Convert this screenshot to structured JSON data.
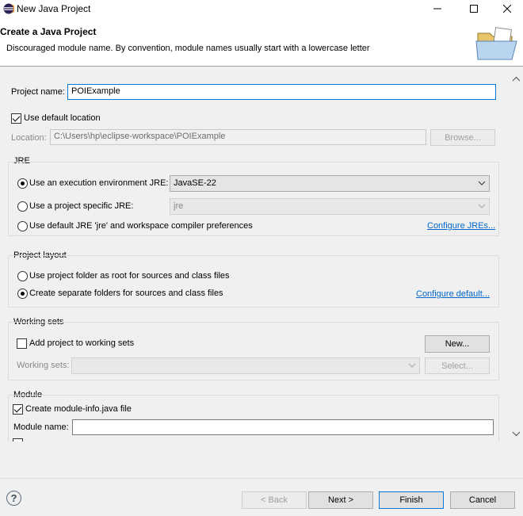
{
  "window": {
    "title": "New Java Project"
  },
  "header": {
    "title": "Create a Java Project",
    "description": "Discouraged module name. By convention, module names usually start with a lowercase letter"
  },
  "project": {
    "name_label": "Project name:",
    "name_value": "POIExample",
    "use_default_location_label": "Use default location",
    "location_label": "Location:",
    "location_value": "C:\\Users\\hp\\eclipse-workspace\\POIExample",
    "browse_label": "Browse..."
  },
  "jre": {
    "group_label": "JRE",
    "exec_env_label": "Use an execution environment JRE:",
    "exec_env_value": "JavaSE-22",
    "specific_label": "Use a project specific JRE:",
    "specific_value": "jre",
    "default_label": "Use default JRE 'jre' and workspace compiler preferences",
    "configure_link": "Configure JREs..."
  },
  "layout": {
    "group_label": "Project layout",
    "root_label": "Use project folder as root for sources and class files",
    "separate_label": "Create separate folders for sources and class files",
    "configure_link": "Configure default..."
  },
  "working_sets": {
    "group_label": "Working sets",
    "add_label": "Add project to working sets",
    "new_label": "New...",
    "sets_label": "Working sets:",
    "sets_value": "",
    "select_label": "Select..."
  },
  "module": {
    "group_label": "Module",
    "create_label": "Create module-info.java file",
    "name_label": "Module name:",
    "name_value": ""
  },
  "footer": {
    "help_glyph": "?",
    "back_label": "< Back",
    "next_label": "Next >",
    "finish_label": "Finish",
    "cancel_label": "Cancel"
  },
  "colors": {
    "link": "#0066cc",
    "default_button_border": "#0078d7"
  }
}
